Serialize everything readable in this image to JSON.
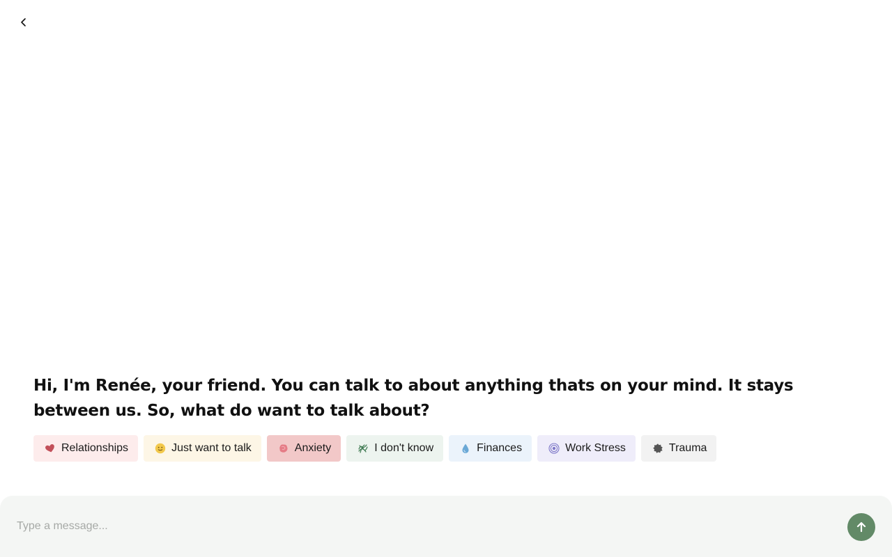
{
  "greeting": "Hi, I'm Renée, your friend. You can talk to about anything thats on your mind. It stays between us. So, what do want to talk about?",
  "topics": [
    {
      "label": "Relationships",
      "icon": "heart-icon",
      "bg": "#fdecec",
      "icon_color": "#c2505a"
    },
    {
      "label": "Just want to talk",
      "icon": "smile-icon",
      "bg": "#fdf6e6",
      "icon_color": "#f2c84b"
    },
    {
      "label": "Anxiety",
      "icon": "anxiety-icon",
      "bg": "#f2c8c8",
      "icon_color": "#e57c86",
      "selected": true
    },
    {
      "label": "I don't know",
      "icon": "tangle-icon",
      "bg": "#edf4ef",
      "icon_color": "#3f7a52"
    },
    {
      "label": "Finances",
      "icon": "drop-icon",
      "bg": "#ebf3fb",
      "icon_color": "#6aa8d6"
    },
    {
      "label": "Work Stress",
      "icon": "spiral-icon",
      "bg": "#efedfa",
      "icon_color": "#7e78c8"
    },
    {
      "label": "Trauma",
      "icon": "cloud-icon",
      "bg": "#f2f2f2",
      "icon_color": "#555555"
    }
  ],
  "composer": {
    "placeholder": "Type a message...",
    "value": ""
  },
  "colors": {
    "send_button": "#628a67",
    "composer_bg": "#f4f6f4"
  }
}
